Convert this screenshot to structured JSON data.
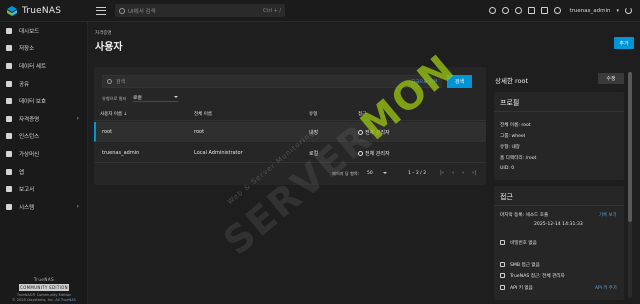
{
  "app": {
    "name": "TrueNAS"
  },
  "topbar": {
    "search_placeholder": "UI에서 검색",
    "search_shortcut": "Ctrl + /",
    "user": "truenas_admin",
    "icons": [
      "jobs-icon",
      "alerts-icon",
      "tasks-icon",
      "updates-icon",
      "notifications-icon",
      "power-icon"
    ]
  },
  "sidebar": {
    "items": [
      {
        "label": "대시보드",
        "icon": "dashboard-icon",
        "chevron": ""
      },
      {
        "label": "저장소",
        "icon": "storage-icon",
        "chevron": ""
      },
      {
        "label": "데이터 세트",
        "icon": "datasets-icon",
        "chevron": ""
      },
      {
        "label": "공유",
        "icon": "shares-icon",
        "chevron": ""
      },
      {
        "label": "데이터 보호",
        "icon": "data-protection-icon",
        "chevron": ""
      },
      {
        "label": "자격증명",
        "icon": "credentials-icon",
        "chevron": "›"
      },
      {
        "label": "인스턴스",
        "icon": "instances-icon",
        "chevron": ""
      },
      {
        "label": "가상머신",
        "icon": "vm-icon",
        "chevron": ""
      },
      {
        "label": "앱",
        "icon": "apps-icon",
        "chevron": ""
      },
      {
        "label": "보고서",
        "icon": "reports-icon",
        "chevron": ""
      },
      {
        "label": "시스템",
        "icon": "system-icon",
        "chevron": "›"
      }
    ],
    "footer": {
      "brand": "TrueNAS",
      "edition": "COMMUNITY EDITION",
      "version": "TrueNAS® Community Edition",
      "copyright": "© 2025 iXsystems, Inc. All",
      "copyright_link": "TrueNAS"
    }
  },
  "main": {
    "breadcrumb": "자격증명",
    "title": "사용자",
    "add_label": "추가",
    "search_placeholder": "검색",
    "advanced_link": "고급으로 전환",
    "search_button": "검색",
    "filter_label": "유형으로 필터",
    "filter_value": "로컬",
    "columns": [
      "사용자 이름 ↓",
      "전체 이름",
      "유형",
      "접근"
    ],
    "rows": [
      {
        "username": "root",
        "full_name": "root",
        "type": "내장",
        "access": "전체 관리자"
      },
      {
        "username": "truenas_admin",
        "full_name": "Local Administrator",
        "type": "로컬",
        "access": "전체 관리자"
      }
    ],
    "pager": {
      "label": "페이지 당 항목:",
      "size": "50",
      "range": "1 – 2 / 2"
    }
  },
  "detail": {
    "title": "상세한 root",
    "edit_label": "수정",
    "profile": {
      "heading": "프로필",
      "full_name": "전체 이름: root",
      "group": "그룹: wheel",
      "type": "유형: 내장",
      "home": "홈 디렉터리: /root",
      "uid": "UID: 0"
    },
    "access": {
      "heading": "접근",
      "last_login_label": "마지막 등록: 세소드 호출",
      "last_login_time": "2025-12-14 14:31:33",
      "history_link": "기록 보기",
      "password": "비밀번호 없음",
      "smb": "SMB 접근 없음",
      "truenas": "TrueNAS 접근: 전체 관리자",
      "api": "API 키 없음",
      "api_link": "API 키 추가"
    }
  },
  "watermark": {
    "main": "SERVER",
    "accent": "MON",
    "small": "Web & Server Monitoring"
  },
  "colors": {
    "accent": "#0095d5",
    "link": "#5fa3d6",
    "background": "#1e1e1e",
    "panel": "#262626"
  }
}
